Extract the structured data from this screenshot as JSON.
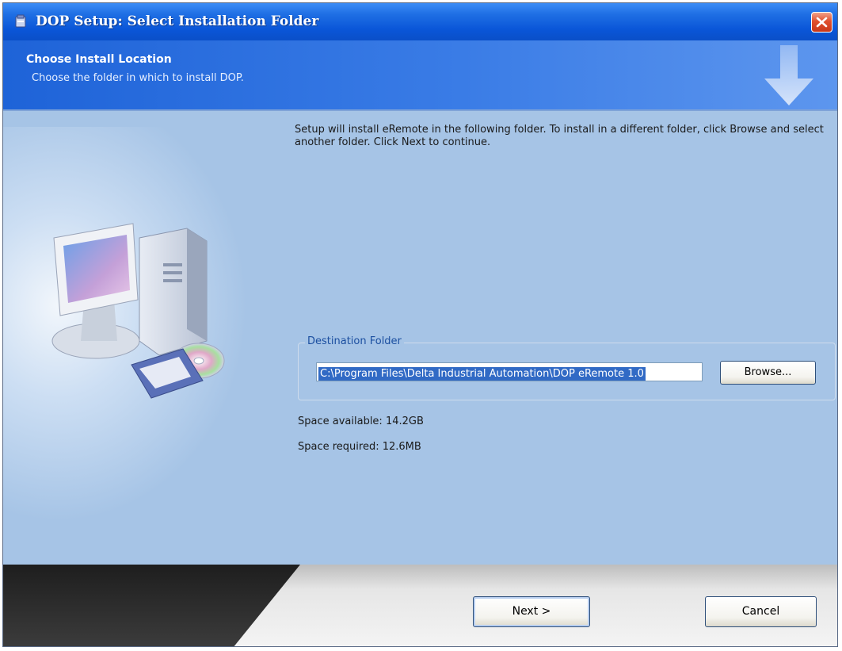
{
  "window": {
    "title": "DOP Setup: Select Installation Folder"
  },
  "header": {
    "title": "Choose Install Location",
    "subtitle": "Choose the folder in which to install DOP."
  },
  "main": {
    "intro": "Setup will install eRemote in the following folder. To install in a different folder, click Browse and select another folder. Click Next to continue.",
    "destination": {
      "legend": "Destination Folder",
      "path": "C:\\Program Files\\Delta Industrial Automation\\DOP eRemote 1.0",
      "browse_label": "Browse..."
    },
    "space_available": "Space available: 14.2GB",
    "space_required": "Space required: 12.6MB"
  },
  "footer": {
    "next_label": "Next >",
    "cancel_label": "Cancel"
  },
  "icons": {
    "app": "installer-icon",
    "close": "close-icon",
    "header": "down-arrow-icon",
    "illustration": "computer-illustration"
  },
  "colors": {
    "titlebar": "#0a56d8",
    "header": "#3a7ce6",
    "body": "#a6c4e6",
    "close": "#e0502e",
    "selection": "#316ac5"
  }
}
